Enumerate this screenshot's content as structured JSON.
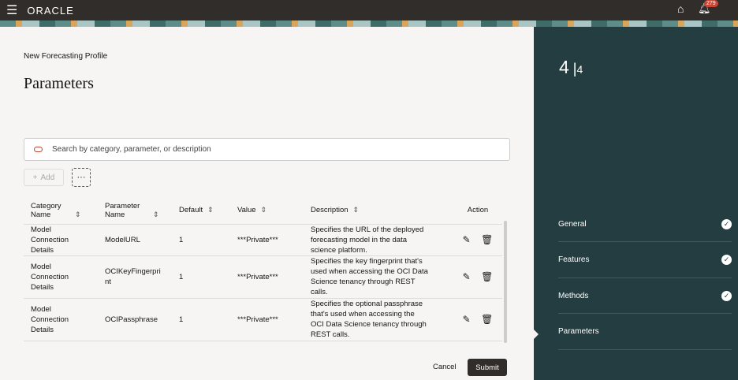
{
  "header": {
    "menu_icon": "hamburger-icon",
    "logo": "ORACLE",
    "notifications": "279"
  },
  "page": {
    "subtitle": "New Forecasting Profile",
    "title": "Parameters"
  },
  "search": {
    "placeholder": "Search by category, parameter, or description"
  },
  "toolbar": {
    "add": "Add",
    "more": "···"
  },
  "table": {
    "headers": [
      "Category Name",
      "Parameter Name",
      "Default",
      "Value",
      "Description",
      "Action"
    ],
    "rows": [
      {
        "category": "Model Connection Details",
        "parameter": "ModelURL",
        "default": "1",
        "value": "***Private***",
        "description": "Specifies the URL of the deployed forecasting model in the data science platform."
      },
      {
        "category": "Model Connection Details",
        "parameter": "OCIKeyFingerprint",
        "default": "1",
        "value": "***Private***",
        "description": "Specifies the key fingerprint that's used when accessing the OCI Data Science tenancy through REST calls."
      },
      {
        "category": "Model Connection Details",
        "parameter": "OCIPassphrase",
        "default": "1",
        "value": "***Private***",
        "description": "Specifies the optional passphrase that's used when accessing the OCI Data Science tenancy through REST calls."
      }
    ]
  },
  "footer": {
    "cancel": "Cancel",
    "submit": "Submit"
  },
  "sidebar": {
    "step_current": "4",
    "step_total": "4",
    "steps": [
      {
        "label": "General"
      },
      {
        "label": "Features"
      },
      {
        "label": "Methods"
      },
      {
        "label": "Parameters"
      }
    ]
  }
}
